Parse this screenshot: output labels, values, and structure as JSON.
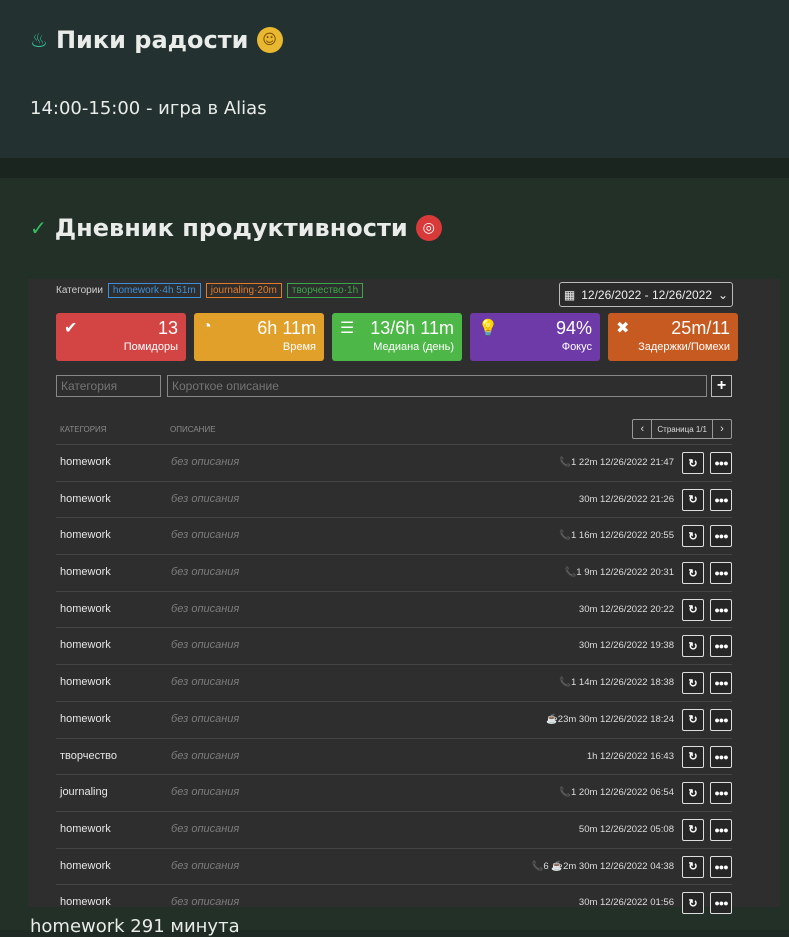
{
  "card1": {
    "title": "Пики радости",
    "line": "14:00-15:00 - игра в Alias"
  },
  "card2": {
    "title": "Дневник продуктивности"
  },
  "widget": {
    "categories_label": "Категории",
    "tags": [
      {
        "label": "homework·4h 51m",
        "color": "#3f8fd8"
      },
      {
        "label": "journaling·20m",
        "color": "#e07b2a"
      },
      {
        "label": "творчество·1h",
        "color": "#3aa64a"
      }
    ],
    "date_range": "12/26/2022 - 12/26/2022",
    "stats": [
      {
        "value": "13",
        "label": "Помидоры",
        "color": "#d34545",
        "icon": "check-circle-icon"
      },
      {
        "value": "6h 11m",
        "label": "Время",
        "color": "#e0a02a",
        "icon": "clock-icon"
      },
      {
        "value": "13/6h 11m",
        "label": "Медиана (день)",
        "color": "#4db848",
        "icon": "list-icon"
      },
      {
        "value": "94%",
        "label": "Фокус",
        "color": "#6d3aa8",
        "icon": "lightbulb-icon"
      },
      {
        "value": "25m/11",
        "label": "Задержки/Помехи",
        "color": "#c75a20",
        "icon": "close-icon"
      }
    ],
    "category_placeholder": "Категория",
    "description_placeholder": "Короткое описание",
    "col_category": "КАТЕГОРИЯ",
    "col_description": "ОПИСАНИЕ",
    "page_label": "Страница 1/1",
    "rows": [
      {
        "category": "homework",
        "description": "без описания",
        "meta": "📞1  22m 12/26/2022 21:47"
      },
      {
        "category": "homework",
        "description": "без описания",
        "meta": "30m 12/26/2022 21:26"
      },
      {
        "category": "homework",
        "description": "без описания",
        "meta": "📞1  16m 12/26/2022 20:55"
      },
      {
        "category": "homework",
        "description": "без описания",
        "meta": "📞1  9m 12/26/2022 20:31"
      },
      {
        "category": "homework",
        "description": "без описания",
        "meta": "30m 12/26/2022 20:22"
      },
      {
        "category": "homework",
        "description": "без описания",
        "meta": "30m 12/26/2022 19:38"
      },
      {
        "category": "homework",
        "description": "без описания",
        "meta": "📞1  14m 12/26/2022 18:38"
      },
      {
        "category": "homework",
        "description": "без описания",
        "meta": "☕23m  30m 12/26/2022 18:24"
      },
      {
        "category": "творчество",
        "description": "без описания",
        "meta": "1h 12/26/2022 16:43"
      },
      {
        "category": "journaling",
        "description": "без описания",
        "meta": "📞1  20m 12/26/2022 06:54"
      },
      {
        "category": "homework",
        "description": "без описания",
        "meta": "50m 12/26/2022 05:08"
      },
      {
        "category": "homework",
        "description": "без описания",
        "meta": "📞6  ☕2m  30m 12/26/2022 04:38"
      },
      {
        "category": "homework",
        "description": "без описания",
        "meta": "30m 12/26/2022 01:56"
      }
    ]
  },
  "footer_text": "homework 291 минута"
}
